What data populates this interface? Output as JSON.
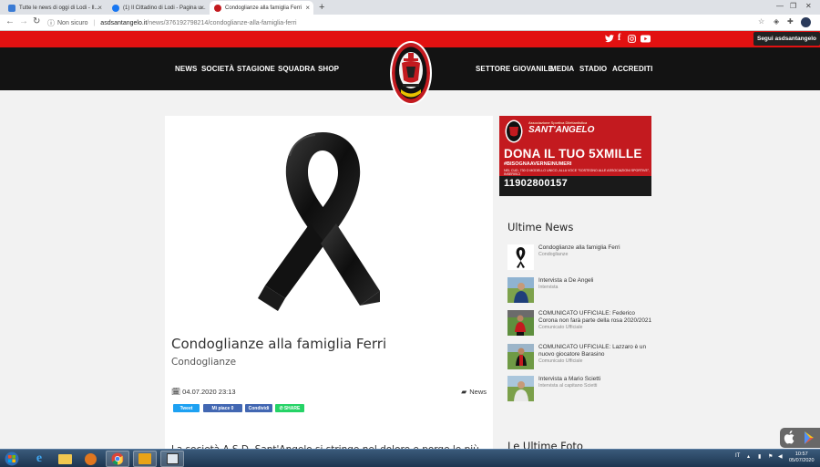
{
  "browser": {
    "tabs": [
      {
        "title": "Tutte le news di oggi di Lodi - Il...",
        "active": false
      },
      {
        "title": "(1) Il Cittadino di Lodi - Pagina u...",
        "active": false
      },
      {
        "title": "Condoglianze alla famiglia Ferri",
        "active": true
      }
    ],
    "url_security": "Non sicuro",
    "url_host": "asdsantangelo.it",
    "url_path": "/news/376192798214/condoglianze-alla-famiglia-ferri"
  },
  "site": {
    "follow_label": "Segui asdsantangelo",
    "nav_left": [
      "NEWS",
      "SOCIETÀ",
      "STAGIONE",
      "SQUADRA",
      "SHOP"
    ],
    "nav_right": [
      "SETTORE GIOVANILE",
      "MEDIA",
      "STADIO",
      "ACCREDITI"
    ],
    "social_icons": [
      "twitter-icon",
      "facebook-icon",
      "instagram-icon",
      "youtube-icon"
    ],
    "accent_color": "#e21111"
  },
  "article": {
    "title": "Condoglianze alla famiglia Ferri",
    "category": "Condoglianze",
    "date": "04.07.2020 23:13",
    "section": "News",
    "share_buttons": [
      "Tweet",
      "Mi piace 0",
      "Condividi",
      "SHARE"
    ],
    "body_start": "La società A.S.D. Sant'Angelo si stringe nel dolore e porge le più"
  },
  "banner": {
    "top_line": "Associazione Sportiva Dilettantistica",
    "brand": "SANT'ANGELO",
    "headline": "DONA IL TUO 5XMILLE",
    "hashtag": "#BISOGNAAVERNEINUMERI",
    "small_text": "NEL CUD, 730 O MODELLO UNICO, ALLA VOCE \"SOSTEGNO ALLE ASSOCIAZIONI SPORTIVE\", INSERISCI",
    "code": "11902800157"
  },
  "sidebar": {
    "latest_news_heading": "Ultime News",
    "latest_photos_heading": "Le Ultime Foto",
    "news": [
      {
        "title": "Condoglianze alla famiglia Ferri",
        "category": "Condoglianze"
      },
      {
        "title": "Intervista a De Angeli",
        "category": "Intervista"
      },
      {
        "title": "COMUNICATO UFFICIALE: Federico Corona non farà parte della rosa 2020/2021",
        "category": "Comunicato Ufficiale"
      },
      {
        "title": "COMUNICATO UFFICIALE: Lazzaro è un nuovo giocatore Barasino",
        "category": "Comunicato Ufficiale"
      },
      {
        "title": "Intervista a Mario Scietti",
        "category": "Intervista al capitano Scietti"
      }
    ]
  },
  "taskbar": {
    "language": "IT",
    "time": "10:57",
    "date": "05/07/2020"
  }
}
